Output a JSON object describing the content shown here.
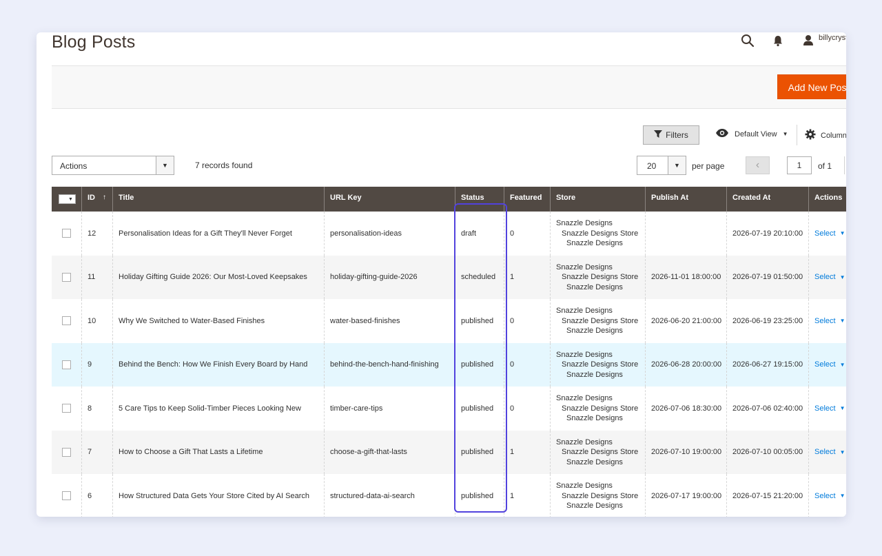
{
  "header": {
    "title": "Blog Posts",
    "username": "billycryst"
  },
  "toolbar": {
    "add_button": "Add New Post"
  },
  "grid_controls": {
    "filters_label": "Filters",
    "view_label": "Default View",
    "columns_label": "Columns",
    "actions_label": "Actions",
    "records_found": "7 records found",
    "per_page_value": "20",
    "per_page_label": "per page",
    "current_page": "1",
    "page_of": "of 1"
  },
  "columns": [
    "ID",
    "Title",
    "URL Key",
    "Status",
    "Featured",
    "Store",
    "Publish At",
    "Created At",
    "Actions"
  ],
  "rows": [
    {
      "id": "12",
      "title": "Personalisation Ideas for a Gift They'll Never Forget",
      "url_key": "personalisation-ideas",
      "status": "draft",
      "featured": "0",
      "store": [
        "Snazzle Designs",
        "Snazzle Designs Store",
        "Snazzle Designs"
      ],
      "publish_at": "",
      "created_at": "2026-07-19 20:10:00",
      "action": "Select"
    },
    {
      "id": "11",
      "title": "Holiday Gifting Guide 2026: Our Most-Loved Keepsakes",
      "url_key": "holiday-gifting-guide-2026",
      "status": "scheduled",
      "featured": "1",
      "store": [
        "Snazzle Designs",
        "Snazzle Designs Store",
        "Snazzle Designs"
      ],
      "publish_at": "2026-11-01 18:00:00",
      "created_at": "2026-07-19 01:50:00",
      "action": "Select"
    },
    {
      "id": "10",
      "title": "Why We Switched to Water-Based Finishes",
      "url_key": "water-based-finishes",
      "status": "published",
      "featured": "0",
      "store": [
        "Snazzle Designs",
        "Snazzle Designs Store",
        "Snazzle Designs"
      ],
      "publish_at": "2026-06-20 21:00:00",
      "created_at": "2026-06-19 23:25:00",
      "action": "Select"
    },
    {
      "id": "9",
      "title": "Behind the Bench: How We Finish Every Board by Hand",
      "url_key": "behind-the-bench-hand-finishing",
      "status": "published",
      "featured": "0",
      "store": [
        "Snazzle Designs",
        "Snazzle Designs Store",
        "Snazzle Designs"
      ],
      "publish_at": "2026-06-28 20:00:00",
      "created_at": "2026-06-27 19:15:00",
      "action": "Select"
    },
    {
      "id": "8",
      "title": "5 Care Tips to Keep Solid-Timber Pieces Looking New",
      "url_key": "timber-care-tips",
      "status": "published",
      "featured": "0",
      "store": [
        "Snazzle Designs",
        "Snazzle Designs Store",
        "Snazzle Designs"
      ],
      "publish_at": "2026-07-06 18:30:00",
      "created_at": "2026-07-06 02:40:00",
      "action": "Select"
    },
    {
      "id": "7",
      "title": "How to Choose a Gift That Lasts a Lifetime",
      "url_key": "choose-a-gift-that-lasts",
      "status": "published",
      "featured": "1",
      "store": [
        "Snazzle Designs",
        "Snazzle Designs Store",
        "Snazzle Designs"
      ],
      "publish_at": "2026-07-10 19:00:00",
      "created_at": "2026-07-10 00:05:00",
      "action": "Select"
    },
    {
      "id": "6",
      "title": "How Structured Data Gets Your Store Cited by AI Search",
      "url_key": "structured-data-ai-search",
      "status": "published",
      "featured": "1",
      "store": [
        "Snazzle Designs",
        "Snazzle Designs Store",
        "Snazzle Designs"
      ],
      "publish_at": "2026-07-17 19:00:00",
      "created_at": "2026-07-15 21:20:00",
      "action": "Select"
    }
  ],
  "colors": {
    "accent": "#eb5202",
    "header_bg": "#514943",
    "link": "#007bdb",
    "highlight_box": "#5142dd",
    "hover_row": "#e5f7fe"
  },
  "icons": [
    "search-icon",
    "bell-icon",
    "user-icon",
    "filter-icon",
    "eye-icon",
    "gear-icon",
    "chevron-down-icon",
    "chevron-left-icon",
    "sort-up-icon"
  ]
}
